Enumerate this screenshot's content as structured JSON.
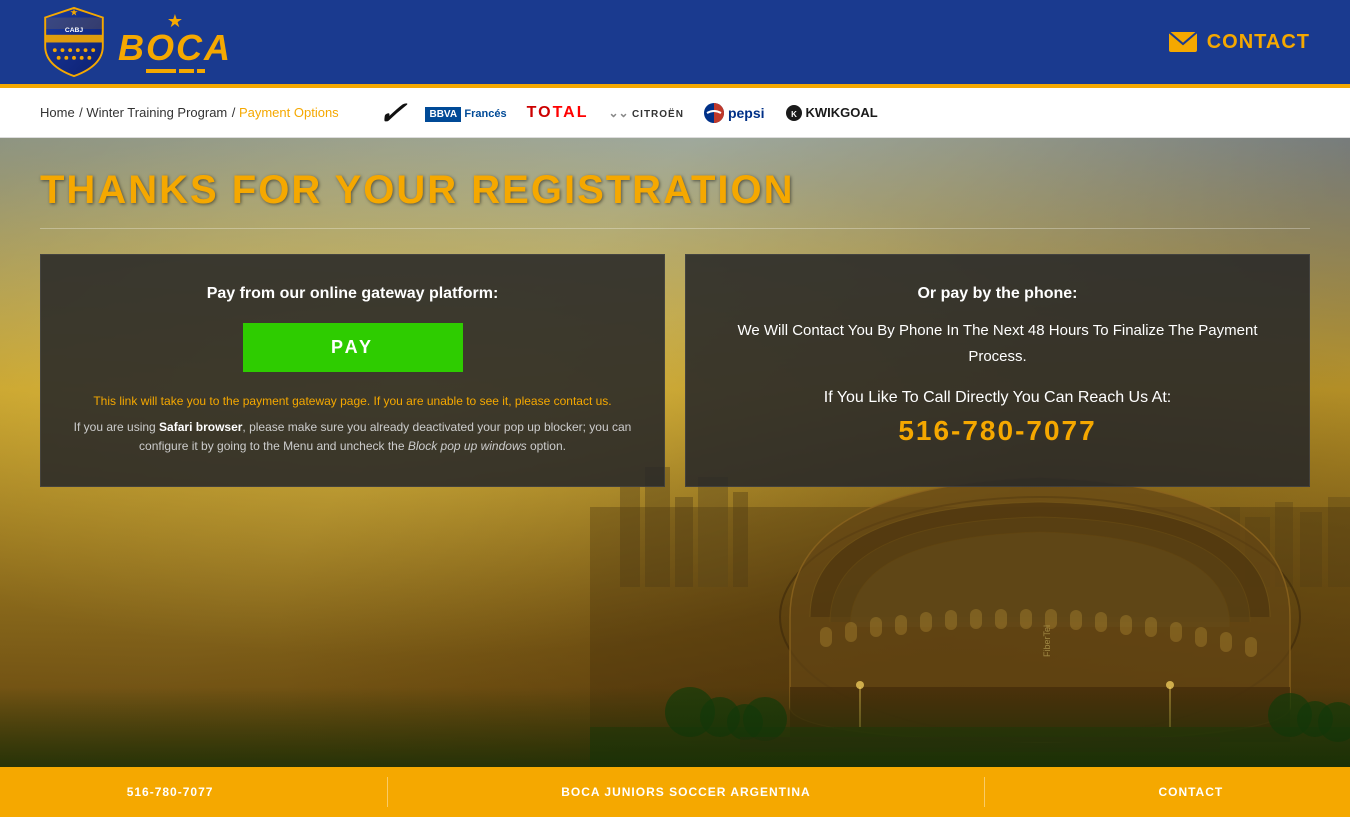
{
  "header": {
    "logo_club": "CABJ",
    "logo_name": "BOCA",
    "contact_label": "CONTACT"
  },
  "breadcrumb": {
    "home": "Home",
    "separator1": " / ",
    "program": "Winter Training Program",
    "separator2": " / ",
    "current": "Payment Options"
  },
  "sponsors": [
    {
      "name": "Nike",
      "display": "✓"
    },
    {
      "name": "BBVA Francés",
      "display": "BBVA Francés"
    },
    {
      "name": "Total",
      "display": "TOTAL"
    },
    {
      "name": "Citroën",
      "display": "CITROËN"
    },
    {
      "name": "Pepsi",
      "display": "pepsi"
    },
    {
      "name": "KwikGoal",
      "display": "KWIKGOAL"
    }
  ],
  "main": {
    "title": "THANKS FOR YOUR REGISTRATION",
    "left_box": {
      "title": "Pay from our online gateway platform:",
      "pay_button": "PAY",
      "warning": "This link will take you to the payment gateway page. If you are unable to see it, please contact us.",
      "info": "If you are using Safari browser, please make sure you already deactivated your pop up blocker; you can configure it by going to the Menu and uncheck the Block pop up windows option."
    },
    "right_box": {
      "title": "Or pay by the phone:",
      "description": "We Will Contact You By Phone In The Next 48 Hours To Finalize The Payment Process.",
      "cta": "If You Like To Call Directly You Can Reach Us At:",
      "phone": "516-780-7077"
    }
  },
  "footer": {
    "col1": "516-780-7077",
    "col2": "BOCA JUNIORS SOCCER ARGENTINA",
    "col3": "CONTACT"
  }
}
